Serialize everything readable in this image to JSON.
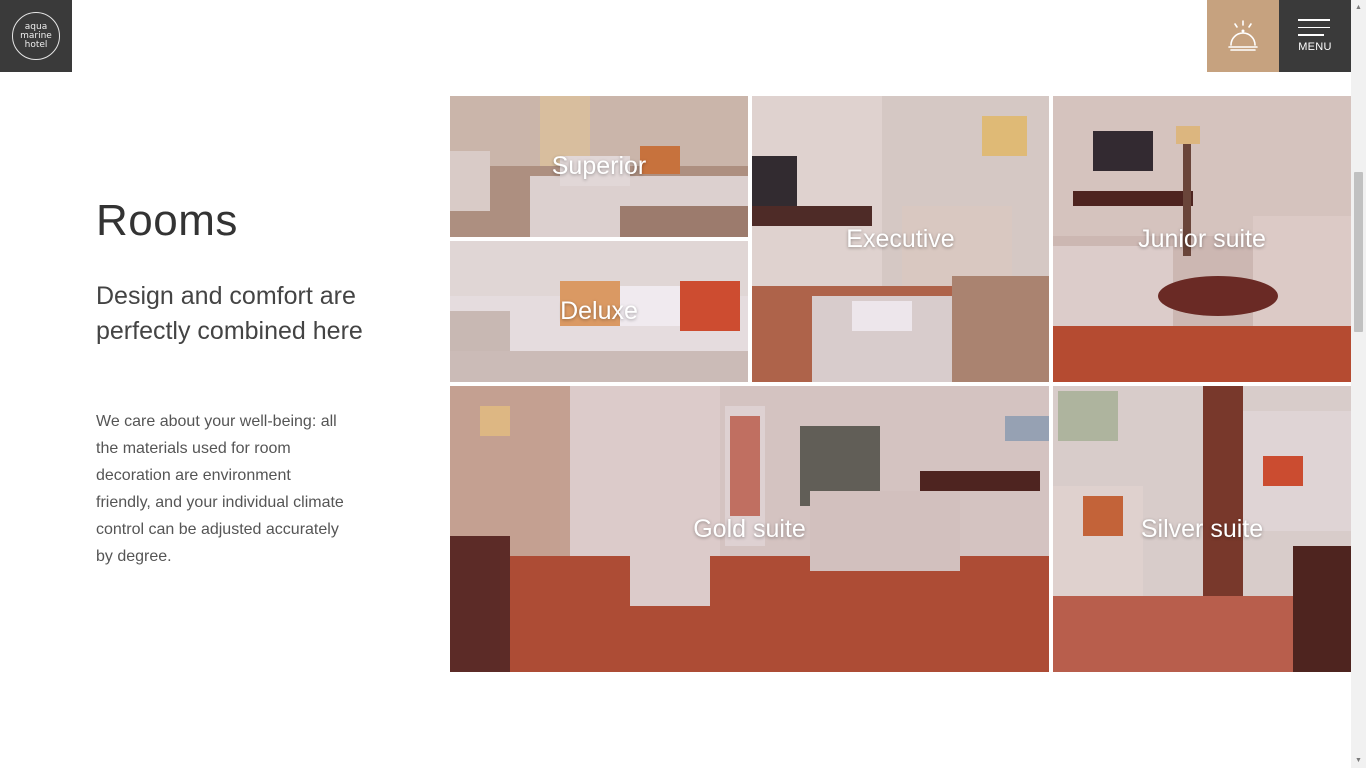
{
  "brand": {
    "logo_lines": [
      "aqua",
      "marine",
      "hotel"
    ]
  },
  "header": {
    "menu_label": "MENU"
  },
  "section": {
    "title": "Rooms",
    "subtitle": "Design and comfort are perfectly combined here",
    "description": "We care about your well-being: all the materials used for room decoration are environment friendly, and your individual climate control can be adjusted accurately by degree."
  },
  "rooms": [
    {
      "label": "Superior"
    },
    {
      "label": "Deluxe"
    },
    {
      "label": "Executive"
    },
    {
      "label": "Junior suite"
    },
    {
      "label": "Gold suite"
    },
    {
      "label": "Silver suite"
    }
  ],
  "icons": {
    "logo": "logo-icon",
    "bell": "reception-bell-icon",
    "menu": "hamburger-menu-icon"
  },
  "colors": {
    "dark": "#3a3a3a",
    "accent": "#c6a27f",
    "text": "#333333"
  }
}
